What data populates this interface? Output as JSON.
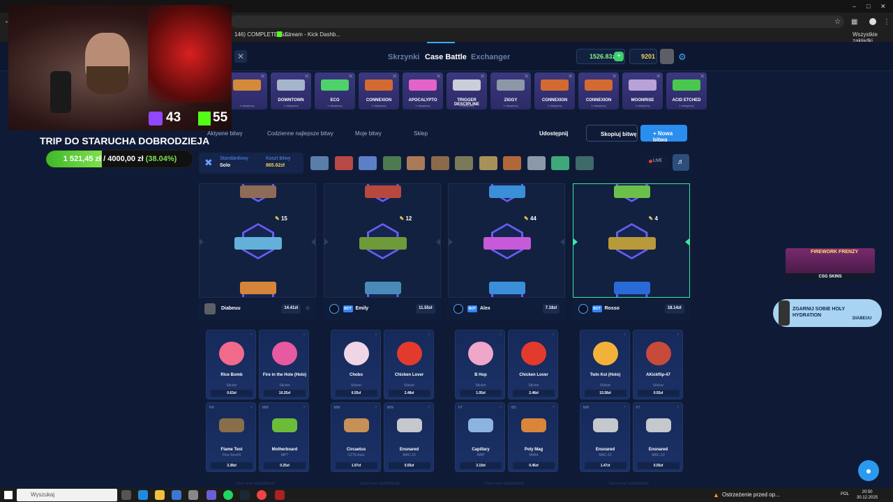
{
  "browser": {
    "tab_title": "146) COMPLETE Su...",
    "tab2": "Stream - Kick Dashb...",
    "bookmarks_all": "Wszystkie zakładki"
  },
  "nav": {
    "tabs": [
      "Skrzynki",
      "Case Battle",
      "Exchanger"
    ],
    "balance": "1526.83zł",
    "coins": "9201"
  },
  "cases_strip": [
    {
      "name": "",
      "color": "#d58a3a"
    },
    {
      "name": "DOWNTOWN",
      "color": "#a7b5cc"
    },
    {
      "name": "ECO",
      "color": "#4fd26a"
    },
    {
      "name": "CONNEXION",
      "color": "#d36a32"
    },
    {
      "name": "APOCALYPTO",
      "color": "#e264c8"
    },
    {
      "name": "TRIGGER DESCIPLINE",
      "color": "#c9ced9"
    },
    {
      "name": "ZIGGY",
      "color": "#8e97a8"
    },
    {
      "name": "CONNEXION",
      "color": "#d36a32"
    },
    {
      "name": "CONNEXION",
      "color": "#d36a32"
    },
    {
      "name": "MOONRISE",
      "color": "#b9a2d6"
    },
    {
      "name": "ACID ETCHED",
      "color": "#48c84e"
    }
  ],
  "case_sub": "1 zakupiony",
  "tabs_row": {
    "active": "Aktywne bitwy",
    "daily": "Codzienne najlepsze bitwy",
    "mine": "Moje bitwy",
    "shop": "Sklep",
    "share": "Udostępnij",
    "copy": "Skopiuj bitwę",
    "new": "+ Nowa bitwa"
  },
  "mode": {
    "type": "Standardowy",
    "sub": "Solo",
    "cost_label": "Koszt bitwy",
    "cost": "865.62zł"
  },
  "live": "LIVE",
  "reels": [
    {
      "count": "15"
    },
    {
      "count": "12"
    },
    {
      "count": "44"
    },
    {
      "count": "4"
    }
  ],
  "players": [
    {
      "name": "Diabeuu",
      "bot": "",
      "value": "14.41zł"
    },
    {
      "name": "Emily",
      "bot": "BOT",
      "value": "11.55zł"
    },
    {
      "name": "Alex",
      "bot": "BOT",
      "value": "7.18zł"
    },
    {
      "name": "Rosso",
      "bot": "BOT",
      "value": "18.14zł"
    }
  ],
  "items": [
    [
      {
        "wear": "",
        "name": "Rice Bomb",
        "sub": "Sticker",
        "price": "0.63zł",
        "color": "#f26a8a"
      },
      {
        "wear": "",
        "name": "Fire in the Hole (Holo)",
        "sub": "Sticker",
        "price": "10.25zł",
        "color": "#e85aa0"
      },
      {
        "wear": "FN",
        "name": "Flame Test",
        "sub": "Five-SeveN",
        "price": "3.38zł",
        "color": "#8a6e4a"
      },
      {
        "wear": "MW",
        "name": "Motherboard",
        "sub": "MP7",
        "price": "0.25zł",
        "color": "#6cbc3a"
      }
    ],
    [
      {
        "wear": "",
        "name": "Chobo",
        "sub": "Sticker",
        "price": "6.55zł",
        "color": "#f0d6e4"
      },
      {
        "wear": "",
        "name": "Chicken Lover",
        "sub": "Sticker",
        "price": "2.48zł",
        "color": "#e23b2e"
      },
      {
        "wear": "MW",
        "name": "Circaetus",
        "sub": "CZ75-Auto",
        "price": "1.97zł",
        "color": "#c79056"
      },
      {
        "wear": "WW",
        "name": "Ensnared",
        "sub": "MAC-10",
        "price": "0.55zł",
        "color": "#c5c8cc"
      }
    ],
    [
      {
        "wear": "",
        "name": "B Hop",
        "sub": "Sticker",
        "price": "1.05zł",
        "color": "#f0a6c8"
      },
      {
        "wear": "",
        "name": "Chicken Lover",
        "sub": "Sticker",
        "price": "2.48zł",
        "color": "#e23b2e"
      },
      {
        "wear": "FT",
        "name": "Capillary",
        "sub": "AWP",
        "price": "3.19zł",
        "color": "#8cb4e0"
      },
      {
        "wear": "BS",
        "name": "Poly Mag",
        "sub": "M4A4",
        "price": "0.46zł",
        "color": "#d9863a"
      }
    ],
    [
      {
        "wear": "",
        "name": "Twin Koi (Holo)",
        "sub": "Sticker",
        "price": "15.58zł",
        "color": "#f2b23a"
      },
      {
        "wear": "",
        "name": "AKickflip-47",
        "sub": "Sticker",
        "price": "0.55zł",
        "color": "#c84a3a"
      },
      {
        "wear": "MW",
        "name": "Ensnared",
        "sub": "MAC-10",
        "price": "1.47zł",
        "color": "#c5c8cc"
      },
      {
        "wear": "FT",
        "name": "Ensnared",
        "sub": "MAC-10",
        "price": "0.55zł",
        "color": "#c5c8cc"
      }
    ]
  ],
  "seeds": [
    "Client seed: a6d5d8f3bd0",
    "Client seed: a6d5d8f3bd0",
    "Client seed: a6d5d8f3bd0",
    "Client seed: a6d5d8f3bd0"
  ],
  "stream": {
    "twitch": "43",
    "kick": "55",
    "goal_title": "TRIP DO STARUCHA DOBRODZIEJA",
    "goal_current": "1 521,45 zł",
    "goal_target": "4000,00 zł",
    "goal_pct": "(38.04%)",
    "goal_fraction": 0.3804
  },
  "ads": {
    "ad1_title": "FIREWORK FRENZY",
    "ad1_brand": "CSG SKINS",
    "ad2_text": "ZGARNIJ SOBIE HOLY HYDRATION",
    "ad2_brand": "DIABEUU"
  },
  "taskbar": {
    "search": "Wyszukaj",
    "alert": "Ostrzeżenie przed op...",
    "lang": "POL",
    "time": "20:50",
    "date": "30.12.2025"
  }
}
